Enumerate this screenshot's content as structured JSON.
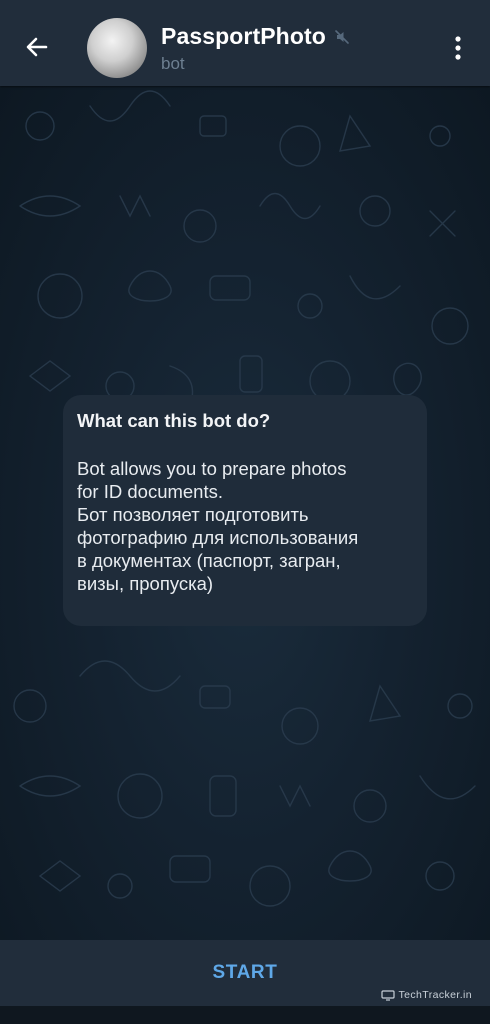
{
  "header": {
    "title": "PassportPhoto",
    "subtitle": "bot",
    "back_icon": "arrow-left-icon",
    "mute_icon": "muted-speaker-icon",
    "menu_icon": "vertical-dots-icon"
  },
  "bubble": {
    "title": "What can this bot do?",
    "text": "Bot allows you to prepare photos\nfor ID documents.\nБот позволяет подготовить\nфотографию для использования\nв документах (паспорт, загран,\nвизы, пропуска)"
  },
  "bottom": {
    "start_label": "START"
  },
  "watermark": {
    "text": "TechTracker.in"
  },
  "colors": {
    "header_bg": "#212d3b",
    "chat_bg": "#142230",
    "bubble_bg": "#1f2c3a",
    "accent": "#5fa8e8",
    "subtitle": "#6d7f91"
  }
}
